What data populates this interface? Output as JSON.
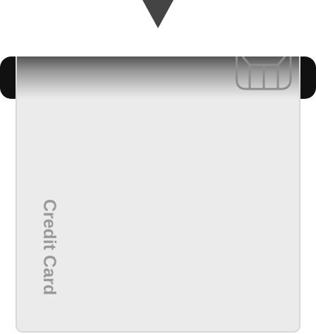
{
  "card": {
    "label": "Credit Card"
  },
  "icons": {
    "insert": "triangle-down-icon",
    "chip": "chip-icon"
  }
}
